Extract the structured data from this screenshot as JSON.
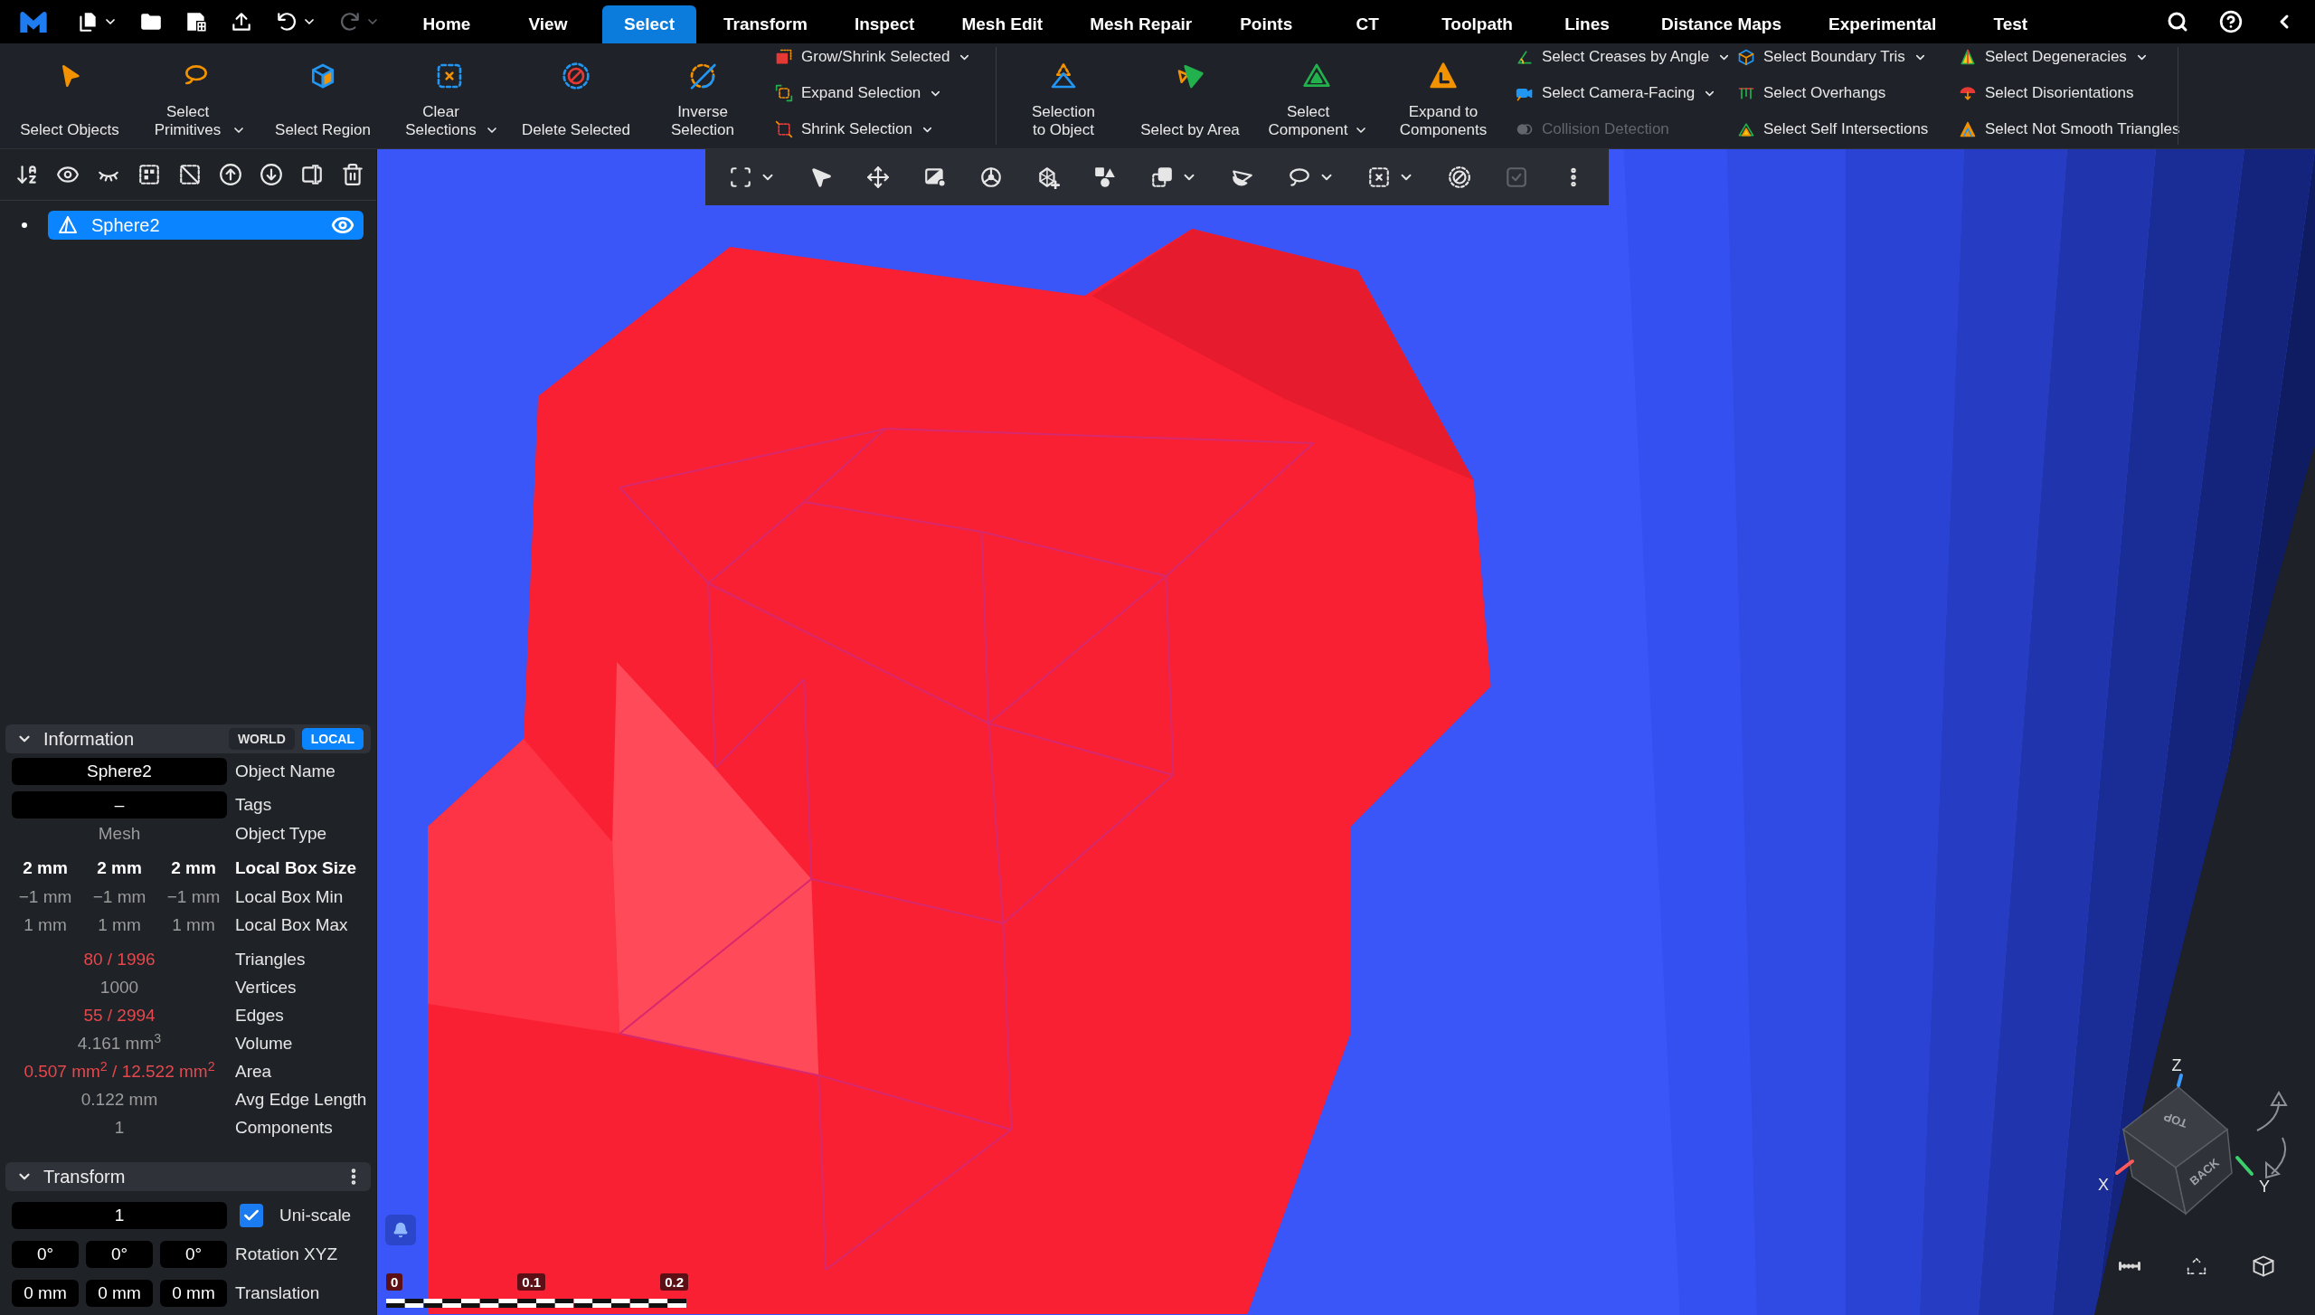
{
  "top_bar": {
    "quick_access": [
      {
        "dropdown": true,
        "disabled": false
      },
      {
        "dropdown": false,
        "disabled": false
      },
      {
        "dropdown": false,
        "disabled": false
      },
      {
        "dropdown": false,
        "disabled": false
      },
      {
        "dropdown": true,
        "disabled": false
      },
      {
        "dropdown": true,
        "disabled": true
      }
    ],
    "tabs": [
      {
        "label": "Home",
        "selected": false
      },
      {
        "label": "View",
        "selected": false
      },
      {
        "label": "Select",
        "selected": true
      },
      {
        "label": "Transform",
        "selected": false
      },
      {
        "label": "Inspect",
        "selected": false
      },
      {
        "label": "Mesh Edit",
        "selected": false
      },
      {
        "label": "Mesh Repair",
        "selected": false
      },
      {
        "label": "Points",
        "selected": false
      },
      {
        "label": "CT",
        "selected": false
      },
      {
        "label": "Toolpath",
        "selected": false
      },
      {
        "label": "Lines",
        "selected": false
      },
      {
        "label": "Distance Maps",
        "selected": false
      },
      {
        "label": "Experimental",
        "selected": false
      },
      {
        "label": "Test",
        "selected": false
      }
    ]
  },
  "ribbon": {
    "sections": [
      {
        "large_buttons": [
          {
            "label": "Select Objects",
            "dropdown": false
          },
          {
            "label": "Select Primitives",
            "dropdown": true
          },
          {
            "label": "Select Region",
            "dropdown": false
          },
          {
            "label": "Clear Selections",
            "dropdown": true
          },
          {
            "label": "Delete Selected",
            "dropdown": false
          },
          {
            "label": "Inverse Selection",
            "dropdown": false
          }
        ],
        "small_columns": [
          [
            {
              "label": "Grow/Shrink Selected",
              "dropdown": true,
              "disabled": false
            },
            {
              "label": "Expand Selection",
              "dropdown": true,
              "disabled": false
            },
            {
              "label": "Shrink Selection",
              "dropdown": true,
              "disabled": false
            }
          ]
        ]
      },
      {
        "large_buttons": [
          {
            "label": "Selection to Object",
            "dropdown": false
          },
          {
            "label": "Select by Area",
            "dropdown": false
          },
          {
            "label": "Select Component",
            "dropdown": true
          },
          {
            "label": "Expand to Components",
            "dropdown": false
          }
        ],
        "small_columns": [
          [
            {
              "label": "Select Creases by Angle",
              "dropdown": true,
              "disabled": false
            },
            {
              "label": "Select Camera-Facing",
              "dropdown": true,
              "disabled": false
            },
            {
              "label": "Collision Detection",
              "dropdown": false,
              "disabled": true
            }
          ],
          [
            {
              "label": "Select Boundary Tris",
              "dropdown": true,
              "disabled": false
            },
            {
              "label": "Select Overhangs",
              "dropdown": false,
              "disabled": false
            },
            {
              "label": "Select Self Intersections",
              "dropdown": false,
              "disabled": false
            }
          ],
          [
            {
              "label": "Select Degeneracies",
              "dropdown": true,
              "disabled": false
            },
            {
              "label": "Select Disorientations",
              "dropdown": false,
              "disabled": false
            },
            {
              "label": "Select Not Smooth Triangles",
              "dropdown": false,
              "disabled": false
            }
          ]
        ]
      }
    ]
  },
  "scene_tree": [
    {
      "name": "Sphere2",
      "selected": true,
      "visible": true
    }
  ],
  "information": {
    "title": "Information",
    "expanded": true,
    "frames": [
      {
        "label": "WORLD",
        "selected": false
      },
      {
        "label": "LOCAL",
        "selected": true
      }
    ],
    "rows": [
      {
        "kind": "field",
        "values": [
          "Sphere2"
        ],
        "label": "Object Name",
        "highlighted": false
      },
      {
        "kind": "field",
        "values": [
          "–"
        ],
        "label": "Tags",
        "highlighted": false
      },
      {
        "kind": "text",
        "values": [
          "Mesh"
        ],
        "label": "Object Type",
        "highlighted": false
      },
      {
        "kind": "heading",
        "values": [
          "2 mm",
          "2 mm",
          "2 mm"
        ],
        "label": "Local Box Size",
        "highlighted": false
      },
      {
        "kind": "text",
        "values": [
          "−1 mm",
          "−1 mm",
          "−1 mm"
        ],
        "label": "Local Box Min",
        "highlighted": false
      },
      {
        "kind": "text",
        "values": [
          "1 mm",
          "1 mm",
          "1 mm"
        ],
        "label": "Local Box Max",
        "highlighted": false
      },
      {
        "kind": "text",
        "values": [
          "80 / 1996"
        ],
        "label": "Triangles",
        "highlighted": true
      },
      {
        "kind": "text",
        "values": [
          "1000"
        ],
        "label": "Vertices",
        "highlighted": false
      },
      {
        "kind": "text",
        "values": [
          "55 / 2994"
        ],
        "label": "Edges",
        "highlighted": true
      },
      {
        "kind": "text",
        "values": [
          "4.161 mm$^{3}$"
        ],
        "label": "Volume",
        "highlighted": false
      },
      {
        "kind": "text",
        "values": [
          "0.507 mm$^{2}$ / 12.522 mm$^{2}$"
        ],
        "label": "Area",
        "highlighted": true
      },
      {
        "kind": "text",
        "values": [
          "0.122 mm"
        ],
        "label": "Avg Edge Length",
        "highlighted": false
      },
      {
        "kind": "text",
        "values": [
          "1"
        ],
        "label": "Components",
        "highlighted": false
      }
    ]
  },
  "transform": {
    "title": "Transform",
    "expanded": true,
    "rows": [
      {
        "kind": "checkbox_field",
        "values": [
          "1"
        ],
        "checked": true,
        "label": "Uni-scale"
      },
      {
        "kind": "fields",
        "values": [
          "0°",
          "0°",
          "0°"
        ],
        "label": "Rotation XYZ"
      },
      {
        "kind": "fields",
        "values": [
          "0 mm",
          "0 mm",
          "0 mm"
        ],
        "label": "Translation"
      }
    ]
  },
  "viewport": {
    "toolbar": [
      {
        "dropdown": true,
        "disabled": false
      },
      {
        "dropdown": false,
        "disabled": false
      },
      {
        "dropdown": false,
        "disabled": false
      },
      {
        "dropdown": false,
        "disabled": false
      },
      {
        "dropdown": false,
        "disabled": false
      },
      {
        "dropdown": false,
        "disabled": false
      },
      {
        "dropdown": false,
        "disabled": false
      },
      {
        "dropdown": true,
        "disabled": false
      },
      {
        "dropdown": false,
        "disabled": false
      },
      {
        "dropdown": true,
        "disabled": false
      },
      {
        "dropdown": true,
        "disabled": false
      },
      {
        "dropdown": false,
        "disabled": false
      },
      {
        "dropdown": false,
        "disabled": true
      },
      {
        "dropdown": false,
        "disabled": false
      }
    ],
    "scale_bar": {
      "labels": [
        "0",
        "0.1",
        "0.2"
      ]
    },
    "view_cube": {
      "face_labels": [
        "TOP",
        "BACK"
      ],
      "axis_labels": [
        "Z",
        "X",
        "Y"
      ]
    }
  }
}
